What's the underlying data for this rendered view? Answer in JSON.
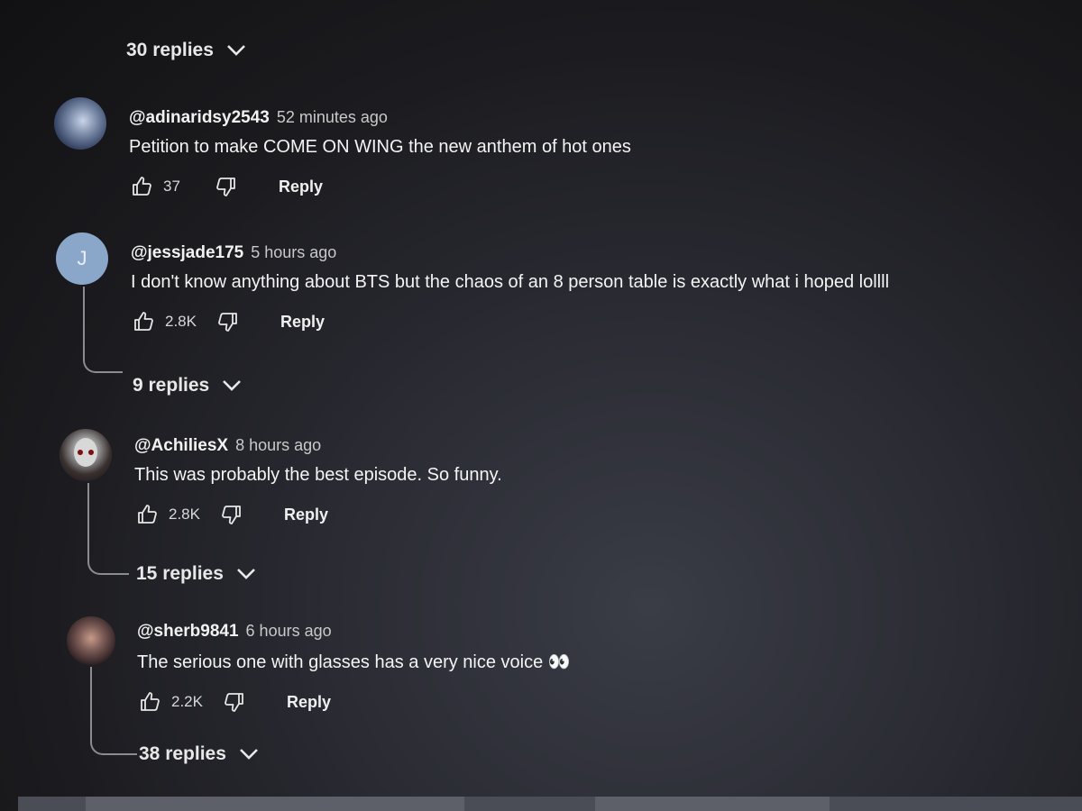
{
  "top_replies": {
    "label": "30 replies"
  },
  "comments": [
    {
      "author": "@adinaridsy2543",
      "time": "52 minutes ago",
      "text": "Petition to make COME ON WING the new anthem of hot ones",
      "likes": "37",
      "reply_label": "Reply",
      "replies": null
    },
    {
      "author": "@jessjade175",
      "time": "5 hours ago",
      "text": "I don't know anything about BTS but the chaos of an 8 person table is exactly what i hoped lollll",
      "likes": "2.8K",
      "reply_label": "Reply",
      "avatar_letter": "J",
      "replies": "9 replies"
    },
    {
      "author": "@AchiliesX",
      "time": "8 hours ago",
      "text": "This was probably the best episode.  So funny.",
      "likes": "2.8K",
      "reply_label": "Reply",
      "replies": "15 replies"
    },
    {
      "author": "@sherb9841",
      "time": "6 hours ago",
      "text": "The serious one with glasses has a very nice voice 👀",
      "likes": "2.2K",
      "reply_label": "Reply",
      "replies": "38 replies"
    }
  ],
  "icons": {
    "like": "thumbs-up-icon",
    "dislike": "thumbs-down-icon",
    "expand": "chevron-down-icon"
  }
}
